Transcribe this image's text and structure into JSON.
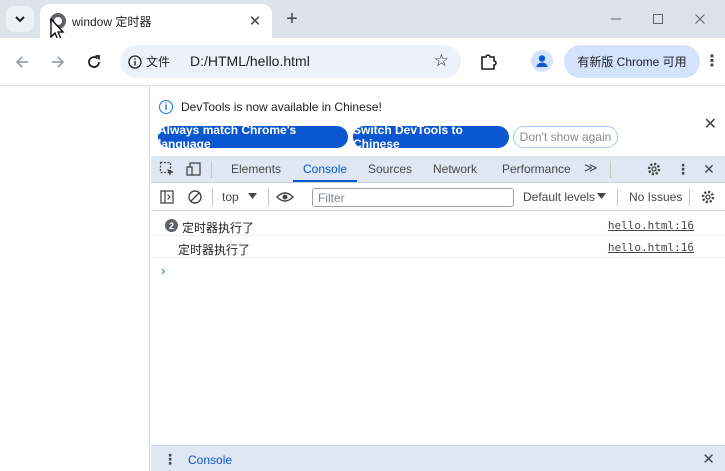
{
  "browser": {
    "tab": {
      "title": "window 定时器",
      "close": "✕"
    },
    "new_tab": "+",
    "window_controls": {
      "minimize": "—",
      "maximize": "☐",
      "close": "✕"
    },
    "omnibox": {
      "chip_label": "文件",
      "url": "D:/HTML/hello.html",
      "star": "☆"
    },
    "update_button": "有新版 Chrome 可用",
    "more": "⋮"
  },
  "devtools": {
    "infobar": {
      "message": "DevTools is now available in Chinese!",
      "buttons": [
        "Always match Chrome's language",
        "Switch DevTools to Chinese",
        "Don't show again"
      ],
      "close": "✕"
    },
    "tabs": [
      "Elements",
      "Console",
      "Sources",
      "Network",
      "Performance"
    ],
    "active_tab": "Console",
    "more_tabs": "≫",
    "close": "✕",
    "console_toolbar": {
      "context": "top",
      "filter_placeholder": "Filter",
      "levels": "Default levels",
      "issues": "No Issues"
    },
    "logs": [
      {
        "count": "2",
        "message": "定时器执行了",
        "source": "hello.html:16"
      },
      {
        "count": "",
        "message": "定时器执行了",
        "source": "hello.html:16"
      }
    ],
    "prompt": "›",
    "drawer": {
      "menu": "⋮",
      "tab": "Console",
      "close": "✕"
    }
  },
  "colors": {
    "accent": "#0b57d0",
    "tabstrip": "#dde3ea",
    "omnibox": "#edf2fa",
    "devtools_bar": "#dfe7f3"
  }
}
